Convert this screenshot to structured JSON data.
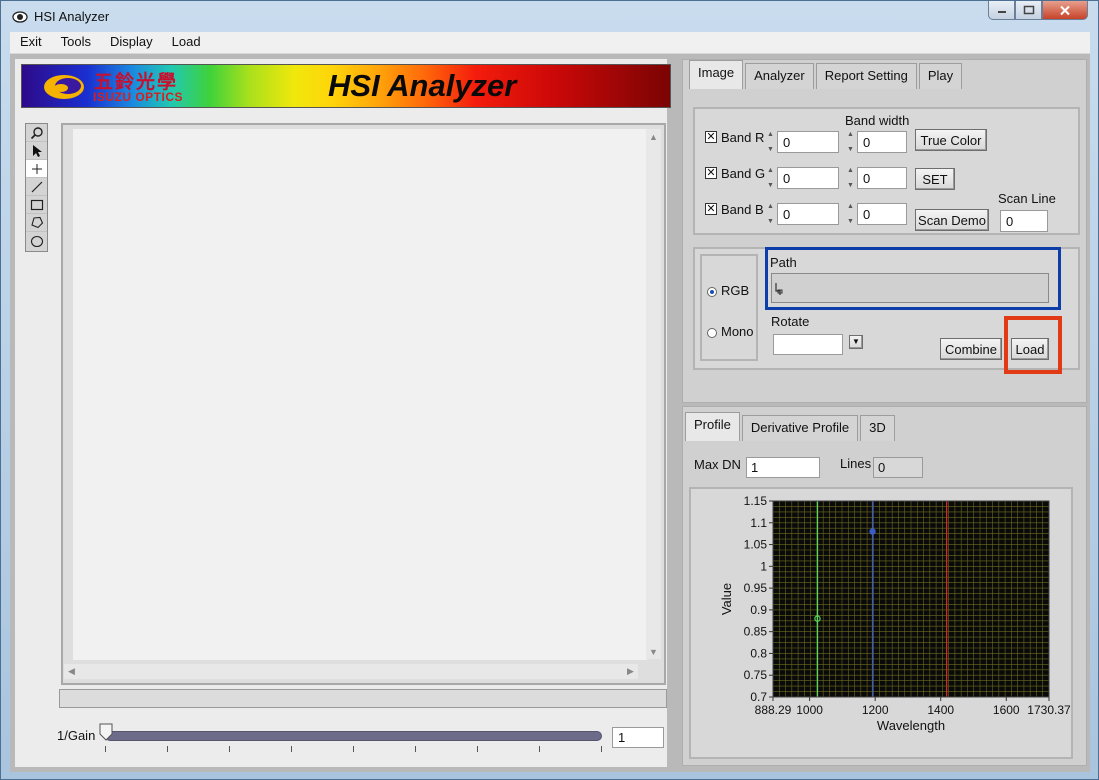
{
  "window": {
    "title": "HSI Analyzer"
  },
  "menu": [
    "Exit",
    "Tools",
    "Display",
    "Load"
  ],
  "banner": {
    "cjk_text": "五鈴光學",
    "company": "ISUZU OPTICS",
    "title": "HSI Analyzer"
  },
  "tools": [
    "zoom-icon",
    "arrow-cursor-icon",
    "crosshair-icon",
    "line-icon",
    "rectangle-icon",
    "polygon-icon",
    "ellipse-icon"
  ],
  "gain": {
    "label": "1/Gain",
    "value": "1",
    "level": 0.0
  },
  "image_tabs": [
    "Image",
    "Analyzer",
    "Report Setting",
    "Play"
  ],
  "bands": {
    "bandwidth_label": "Band width",
    "rows": [
      {
        "label": "Band R",
        "checked": true,
        "band": "0",
        "width": "0"
      },
      {
        "label": "Band G",
        "checked": true,
        "band": "0",
        "width": "0"
      },
      {
        "label": "Band B",
        "checked": true,
        "band": "0",
        "width": "0"
      }
    ],
    "true_color_label": "True Color",
    "set_label": "SET",
    "scan_demo_label": "Scan Demo",
    "scan_line_label": "Scan Line",
    "scan_line_value": "0"
  },
  "load_panel": {
    "rgb_label": "RGB",
    "mono_label": "Mono",
    "mode_selected": "RGB",
    "path_label": "Path",
    "path_value": "",
    "rotate_label": "Rotate",
    "rotate_value": "",
    "combine_label": "Combine",
    "load_label": "Load",
    "highlight_path_color": "#0d3da8",
    "highlight_load_color": "#e23a14"
  },
  "profile_tabs": [
    "Profile",
    "Derivative Profile",
    "3D"
  ],
  "profile": {
    "max_dn_label": "Max DN",
    "max_dn_value": "1",
    "lines_label": "Lines",
    "lines_value": "0"
  },
  "chart_data": {
    "type": "line",
    "xlabel": "Wavelength",
    "ylabel": "Value",
    "xlim": [
      888.29,
      1730.37
    ],
    "ylim": [
      0.7,
      1.15
    ],
    "x_ticks": [
      "888.29",
      "1000",
      "1200",
      "1400",
      "1600",
      "1730.37"
    ],
    "y_ticks": [
      "1.15",
      "1.1",
      "1.05",
      "1",
      "0.95",
      "0.9",
      "0.85",
      "0.8",
      "0.75",
      "0.7"
    ],
    "grid": true,
    "cursors": [
      {
        "color": "#5ad65a",
        "x": 1024,
        "marker_y": 0.88
      },
      {
        "color": "#3a5cc8",
        "x": 1192,
        "marker_y": 1.08
      },
      {
        "color": "#d42a2a",
        "x": 1418
      }
    ],
    "background": "#0a0a0a",
    "grid_color": "#6b6b1e"
  }
}
